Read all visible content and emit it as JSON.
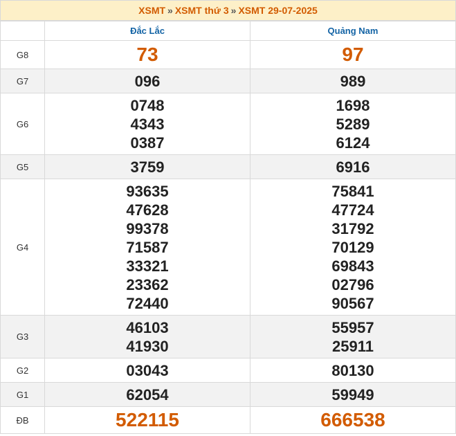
{
  "breadcrumb": {
    "items": [
      "XSMT",
      "XSMT thứ 3",
      "XSMT 29-07-2025"
    ],
    "separator": "»"
  },
  "provinces": [
    "Đắc Lắc",
    "Quảng Nam"
  ],
  "prizes": [
    {
      "label": "G8",
      "values": [
        [
          "73"
        ],
        [
          "97"
        ]
      ]
    },
    {
      "label": "G7",
      "values": [
        [
          "096"
        ],
        [
          "989"
        ]
      ]
    },
    {
      "label": "G6",
      "values": [
        [
          "0748",
          "4343",
          "0387"
        ],
        [
          "1698",
          "5289",
          "6124"
        ]
      ]
    },
    {
      "label": "G5",
      "values": [
        [
          "3759"
        ],
        [
          "6916"
        ]
      ]
    },
    {
      "label": "G4",
      "values": [
        [
          "93635",
          "47628",
          "99378",
          "71587",
          "33321",
          "23362",
          "72440"
        ],
        [
          "75841",
          "47724",
          "31792",
          "70129",
          "69843",
          "02796",
          "90567"
        ]
      ]
    },
    {
      "label": "G3",
      "values": [
        [
          "46103",
          "41930"
        ],
        [
          "55957",
          "25911"
        ]
      ]
    },
    {
      "label": "G2",
      "values": [
        [
          "03043"
        ],
        [
          "80130"
        ]
      ]
    },
    {
      "label": "G1",
      "values": [
        [
          "62054"
        ],
        [
          "59949"
        ]
      ]
    },
    {
      "label": "ĐB",
      "values": [
        [
          "522115"
        ],
        [
          "666538"
        ]
      ]
    }
  ],
  "colors": {
    "accent": "#d25b00",
    "header_text": "#1464a5",
    "breadcrumb_bg": "#fdf0c8",
    "alt_row_bg": "#f2f2f2"
  }
}
